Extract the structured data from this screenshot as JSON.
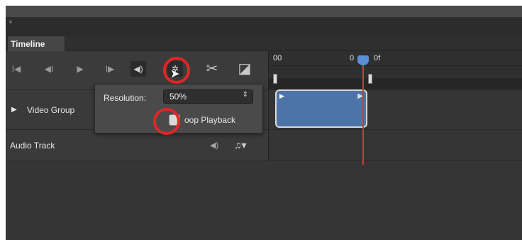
{
  "window": {
    "close_glyph": "×"
  },
  "panel": {
    "tab_label": "Timeline"
  },
  "toolbar": {
    "buttons": [
      {
        "name": "go-to-first-frame-icon",
        "glyph": "I◀"
      },
      {
        "name": "previous-frame-icon",
        "glyph": "◀I"
      },
      {
        "name": "play-icon",
        "glyph": "▶"
      },
      {
        "name": "next-frame-icon",
        "glyph": "I▶"
      },
      {
        "name": "mute-audio-icon",
        "glyph": "◀)"
      },
      {
        "name": "playback-settings-gear-icon",
        "glyph": "✲"
      },
      {
        "name": "split-at-playhead-scissors-icon",
        "glyph": "✂"
      },
      {
        "name": "transition-icon",
        "glyph": "◪"
      }
    ]
  },
  "ruler": {
    "start_label": "00",
    "playhead_label": "0",
    "playhead_frame": "0f"
  },
  "tracks": {
    "video_group": {
      "label": "Video Group",
      "expand_glyph": "▶"
    },
    "audio_track": {
      "label": "Audio Track",
      "audio_glyph": "◀)",
      "music_glyph": "♫▾"
    }
  },
  "clip": {
    "start_glyph": "▶",
    "end_glyph": "▶"
  },
  "settings_popup": {
    "resolution_label": "Resolution:",
    "resolution_value": "50%",
    "select_arrows": "⇕",
    "loop_label": "oop Playback",
    "loop_checked": false
  },
  "colors": {
    "panel_bg": "#3a3a3a",
    "clip_fill": "#4d74a8",
    "playhead": "#d03a3a",
    "annotation_ring": "#e02626"
  }
}
